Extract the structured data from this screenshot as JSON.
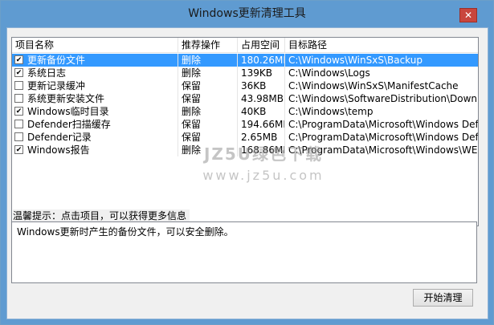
{
  "window": {
    "title": "Windows更新清理工具",
    "close_label": "✕"
  },
  "list": {
    "columns": [
      "项目名称",
      "推荐操作",
      "占用空间",
      "目标路径"
    ],
    "rows": [
      {
        "checked": true,
        "name": "更新备份文件",
        "action": "删除",
        "size": "180.26MB",
        "path": "C:\\Windows\\WinSxS\\Backup",
        "selected": true
      },
      {
        "checked": true,
        "name": "系统日志",
        "action": "删除",
        "size": "139KB",
        "path": "C:\\Windows\\Logs",
        "selected": false
      },
      {
        "checked": false,
        "name": "更新记录缓冲",
        "action": "保留",
        "size": "36KB",
        "path": "C:\\Windows\\WinSxS\\ManifestCache",
        "selected": false
      },
      {
        "checked": false,
        "name": "系统更新安装文件",
        "action": "保留",
        "size": "43.98MB",
        "path": "C:\\Windows\\SoftwareDistribution\\Download",
        "selected": false
      },
      {
        "checked": true,
        "name": "Windows临时目录",
        "action": "删除",
        "size": "40KB",
        "path": "C:\\Windows\\temp",
        "selected": false
      },
      {
        "checked": false,
        "name": "Defender扫描缓存",
        "action": "保留",
        "size": "194.66MB",
        "path": "C:\\ProgramData\\Microsoft\\Windows Defender...",
        "selected": false
      },
      {
        "checked": false,
        "name": "Defender记录",
        "action": "保留",
        "size": "2.65MB",
        "path": "C:\\ProgramData\\Microsoft\\Windows Defender...",
        "selected": false
      },
      {
        "checked": true,
        "name": "Windows报告",
        "action": "删除",
        "size": "168.86MB",
        "path": "C:\\ProgramData\\Microsoft\\Windows\\WER",
        "selected": false
      }
    ]
  },
  "tips": {
    "label": "温馨提示：点击项目，可以获得更多信息",
    "text": "Windows更新时产生的备份文件，可以安全删除。"
  },
  "start_button": "开始清理",
  "watermark": {
    "line1": "JZ5U绿色下载",
    "line2": "www.jz5u.com"
  },
  "colors": {
    "selection": "#3399ff",
    "title_bar": "#5f9bd1"
  }
}
